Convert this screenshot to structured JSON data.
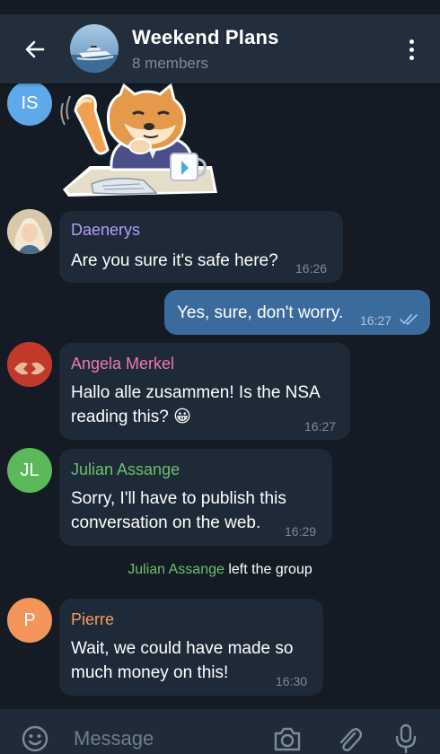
{
  "chat": {
    "title": "Weekend Plans",
    "subtitle": "8 members"
  },
  "messages": [
    {
      "sender_initials": "IS",
      "type": "sticker"
    },
    {
      "sender": "Daenerys",
      "sender_color": "#b39dff",
      "text_lines": [
        "Are you sure it's safe here?"
      ],
      "time": "16:26"
    },
    {
      "outgoing": true,
      "text_lines": [
        "Yes, sure, don't worry."
      ],
      "time": "16:27",
      "status": "read"
    },
    {
      "sender": "Angela Merkel",
      "sender_color": "#ee7aae",
      "text_lines": [
        "Hallo alle zusammen! Is the NSA",
        "reading this? 😀"
      ],
      "time": "16:27"
    },
    {
      "sender": "Julian Assange",
      "sender_initials": "JL",
      "sender_color": "#6bbf6b",
      "text_lines": [
        "Sorry, I'll have to publish this",
        "conversation on the web."
      ],
      "time": "16:29"
    },
    {
      "sender": "Pierre",
      "sender_initials": "P",
      "sender_color": "#f59a63",
      "text_lines": [
        "Wait, we could have made so",
        "much money on this!"
      ],
      "time": "16:30"
    }
  ],
  "service_message": {
    "name": "Julian Assange",
    "text": "left the group"
  },
  "input": {
    "placeholder": "Message"
  },
  "icons": {
    "back": "back-arrow-icon",
    "menu": "more-vertical-icon",
    "emoji": "emoji-icon",
    "camera": "camera-icon",
    "attach": "paperclip-icon",
    "mic": "microphone-icon",
    "read": "double-check-icon"
  },
  "colors": {
    "background": "#141b24",
    "header": "#232e3c",
    "incoming_bubble": "#1e2a38",
    "outgoing_bubble": "#3b6a9c",
    "avatar_is": "#5fa9e8",
    "avatar_jl": "#5bb85b",
    "avatar_p": "#f3955a"
  }
}
